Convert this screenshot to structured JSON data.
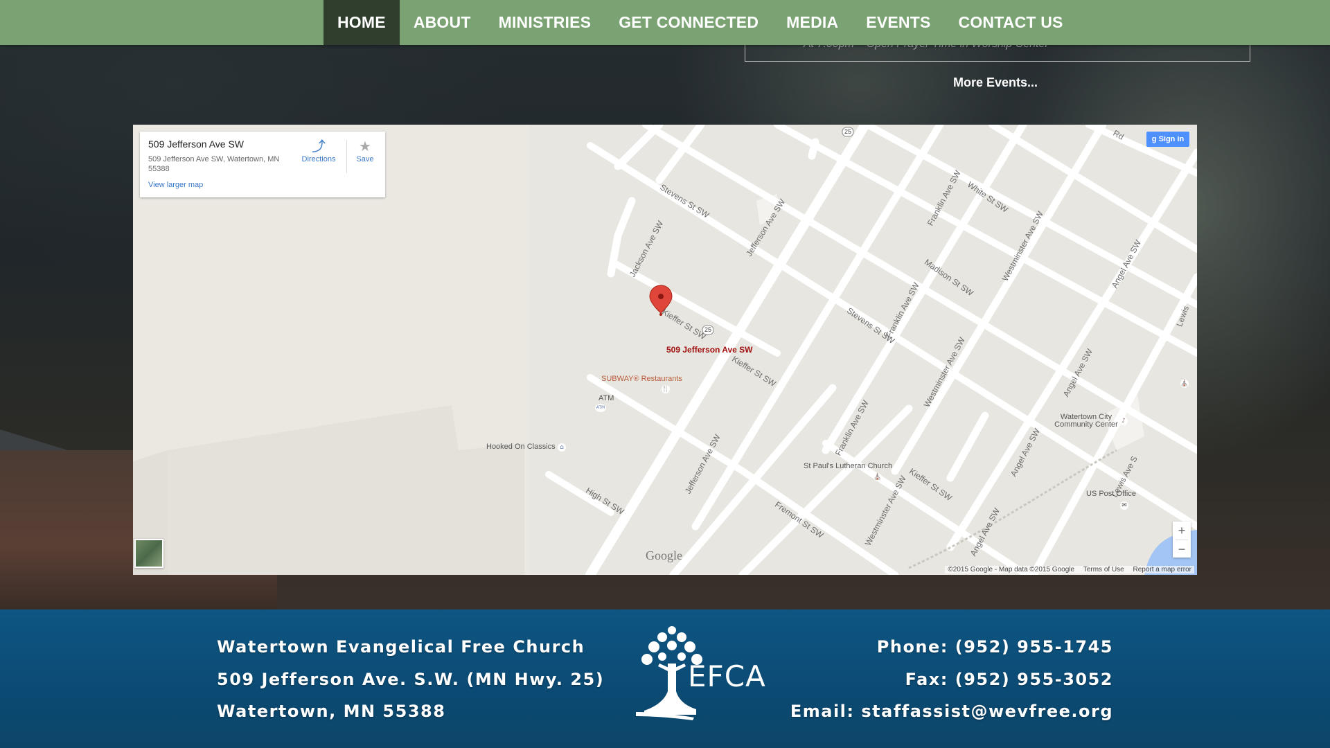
{
  "nav": {
    "items": [
      {
        "label": "HOME",
        "active": true
      },
      {
        "label": "ABOUT"
      },
      {
        "label": "MINISTRIES"
      },
      {
        "label": "GET CONNECTED"
      },
      {
        "label": "MEDIA"
      },
      {
        "label": "EVENTS"
      },
      {
        "label": "CONTACT US"
      }
    ]
  },
  "events": {
    "partial_line": "At 7:00pm – Open Prayer Time in Worship Center",
    "more_link": "More Events..."
  },
  "map": {
    "info_card": {
      "title": "509 Jefferson Ave SW",
      "address": "509 Jefferson Ave SW, Watertown, MN 55388",
      "larger_link": "View larger map",
      "directions_label": "Directions",
      "save_label": "Save"
    },
    "signin_label": "Sign in",
    "marker_label": "509 Jefferson Ave SW",
    "streets": {
      "stevens_1": "Stevens St SW",
      "stevens_2": "Stevens St SW",
      "jackson": "Jackson Ave SW",
      "jefferson_1": "Jefferson Ave SW",
      "jefferson_2": "Jefferson Ave SW",
      "kieffer_1": "Kieffer St SW",
      "kieffer_2": "Kieffer St SW",
      "kieffer_3": "Kieffer St SW",
      "franklin_1": "Franklin Ave SW",
      "franklin_2": "Franklin Ave SW",
      "franklin_3": "Franklin Ave SW",
      "white": "White St SW",
      "westminster_1": "Westminster Ave SW",
      "westminster_2": "Westminster Ave SW",
      "westminster_3": "Westminster Ave SW",
      "madison": "Madison St SW",
      "angel_1": "Angel Ave SW",
      "angel_2": "Angel Ave SW",
      "angel_3": "Angel Ave SW",
      "angel_4": "Angel Ave SW",
      "high": "High St SW",
      "fremont": "Fremont St SW",
      "lewis": "Lewis Ave S",
      "lewis_2": "Lewis",
      "rd": "Rd",
      "route": "25"
    },
    "pois": {
      "subway": "SUBWAY® Restaurants",
      "atm": "ATM",
      "atm_icon": "ATM",
      "hooked": "Hooked On Classics",
      "lutheran": "St Paul's Lutheran Church",
      "community": "Watertown City Community Center",
      "post_office": "US Post Office"
    },
    "google_logo": "Google",
    "footer": {
      "copyright": "©2015 Google - Map data ©2015 Google",
      "terms": "Terms of Use",
      "report": "Report a map error"
    },
    "zoom_in": "+",
    "zoom_out": "−"
  },
  "footer": {
    "left": [
      "Watertown Evangelical Free Church",
      "509 Jefferson Ave. S.W. (MN Hwy. 25)",
      "Watertown, MN 55388"
    ],
    "right": [
      "Phone: (952) 955-1745",
      "Fax: (952) 955-3052",
      "Email: staffassist@wevfree.org"
    ],
    "logo_text": "EFCA"
  },
  "colors": {
    "nav_bg": "#7aa272",
    "nav_active": "#2f3e2d",
    "footer_bg": "#0e5683",
    "link_blue": "#3a78c9",
    "marker_red": "#d93025"
  }
}
